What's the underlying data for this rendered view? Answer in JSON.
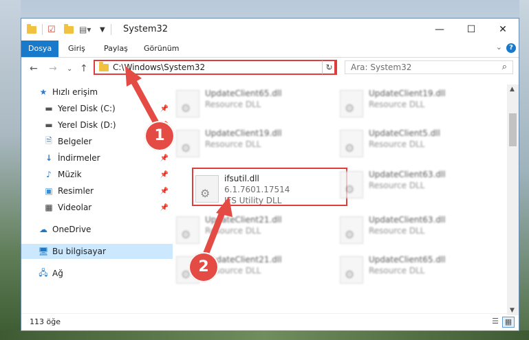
{
  "window": {
    "title": "System32"
  },
  "ribbon": {
    "tabs": [
      "Dosya",
      "Giriş",
      "Paylaş",
      "Görünüm"
    ]
  },
  "navigation": {
    "address": "C:\\Windows\\System32",
    "search_placeholder": "Ara: System32"
  },
  "sidebar": {
    "items": [
      {
        "label": "Hızlı erişim",
        "icon": "star-icon"
      },
      {
        "label": "Yerel Disk (C:)",
        "icon": "drive-icon"
      },
      {
        "label": "Yerel Disk (D:)",
        "icon": "drive-icon"
      },
      {
        "label": "Belgeler",
        "icon": "document-icon"
      },
      {
        "label": "İndirmeler",
        "icon": "download-icon"
      },
      {
        "label": "Müzik",
        "icon": "music-icon"
      },
      {
        "label": "Resimler",
        "icon": "pictures-icon"
      },
      {
        "label": "Videolar",
        "icon": "video-icon"
      },
      {
        "label": "OneDrive",
        "icon": "cloud-icon"
      },
      {
        "label": "Bu bilgisayar",
        "icon": "computer-icon"
      },
      {
        "label": "Ağ",
        "icon": "network-icon"
      }
    ]
  },
  "files": [
    {
      "name": "UpdateClient65.dll",
      "line2": "Resource DLL"
    },
    {
      "name": "UpdateClient19.dll",
      "line2": "Resource DLL"
    },
    {
      "name": "UpdateClient19.dll",
      "line2": "Resource DLL"
    },
    {
      "name": "UpdateClient5.dll",
      "line2": "Resource DLL"
    },
    {
      "name": "ifsutil.dll",
      "line2": "6.1.7601.17514",
      "line3": "IFS Utility DLL"
    },
    {
      "name": "UpdateClient63.dll",
      "line2": "Resource DLL"
    },
    {
      "name": "UpdateClient21.dll",
      "line2": "Resource DLL"
    },
    {
      "name": "UpdateClient63.dll",
      "line2": "Resource DLL"
    },
    {
      "name": "UpdateClient21.dll",
      "line2": "Resource DLL"
    },
    {
      "name": "UpdateClient65.dll",
      "line2": "Resource DLL"
    }
  ],
  "status": {
    "item_count": "113 öğe"
  },
  "annotations": {
    "badge1": "1",
    "badge2": "2"
  },
  "colors": {
    "accent": "#1979ca",
    "highlight": "#e03c3c"
  }
}
